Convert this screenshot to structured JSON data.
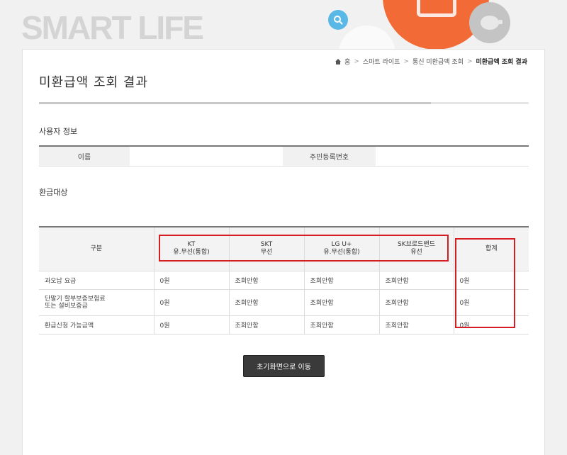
{
  "header": {
    "brand": "SMART LIFE",
    "icons": [
      "search-icon",
      "phone-icon",
      "piggy-bank-icon"
    ],
    "colors": {
      "search": "#5ab8e6",
      "orange": "#f26a35",
      "gray": "#c4c4c4"
    }
  },
  "breadcrumb": {
    "home": "홈",
    "items": [
      "스마트 라이프",
      "통신 미환급액 조회"
    ],
    "current": "미환급액 조회 결과"
  },
  "page": {
    "title": "미환급액 조회 결과",
    "progress": 0.8
  },
  "user_info": {
    "title": "사용자 정보",
    "name_label": "이름",
    "name_value": "",
    "id_label": "주민등록번호",
    "id_value": ""
  },
  "refund": {
    "title": "환급대상",
    "headers": {
      "category": "구분",
      "kt": {
        "name": "KT",
        "type": "유.무선(통합)"
      },
      "skt": {
        "name": "SKT",
        "type": "무선"
      },
      "lgu": {
        "name": "LG U+",
        "type": "유.무선(통합)"
      },
      "skb": {
        "name": "SK브로드밴드",
        "type": "유선"
      },
      "total": "합계"
    },
    "rows": [
      {
        "label": "과오납 요금",
        "label2": "",
        "kt": "0원",
        "skt": "조회안함",
        "lgu": "조회안함",
        "skb": "조회안함",
        "total": "0원"
      },
      {
        "label": "단말기 할부보증보험료",
        "label2": "또는 설비보증금",
        "kt": "0원",
        "skt": "조회안함",
        "lgu": "조회안함",
        "skb": "조회안함",
        "total": "0원"
      },
      {
        "label": "환급신청 가능금액",
        "label2": "",
        "kt": "0원",
        "skt": "조회안함",
        "lgu": "조회안함",
        "skb": "조회안함",
        "total": "0원"
      }
    ]
  },
  "actions": {
    "reset_label": "초기화면으로 이동"
  },
  "highlight_color": "#d71d24"
}
